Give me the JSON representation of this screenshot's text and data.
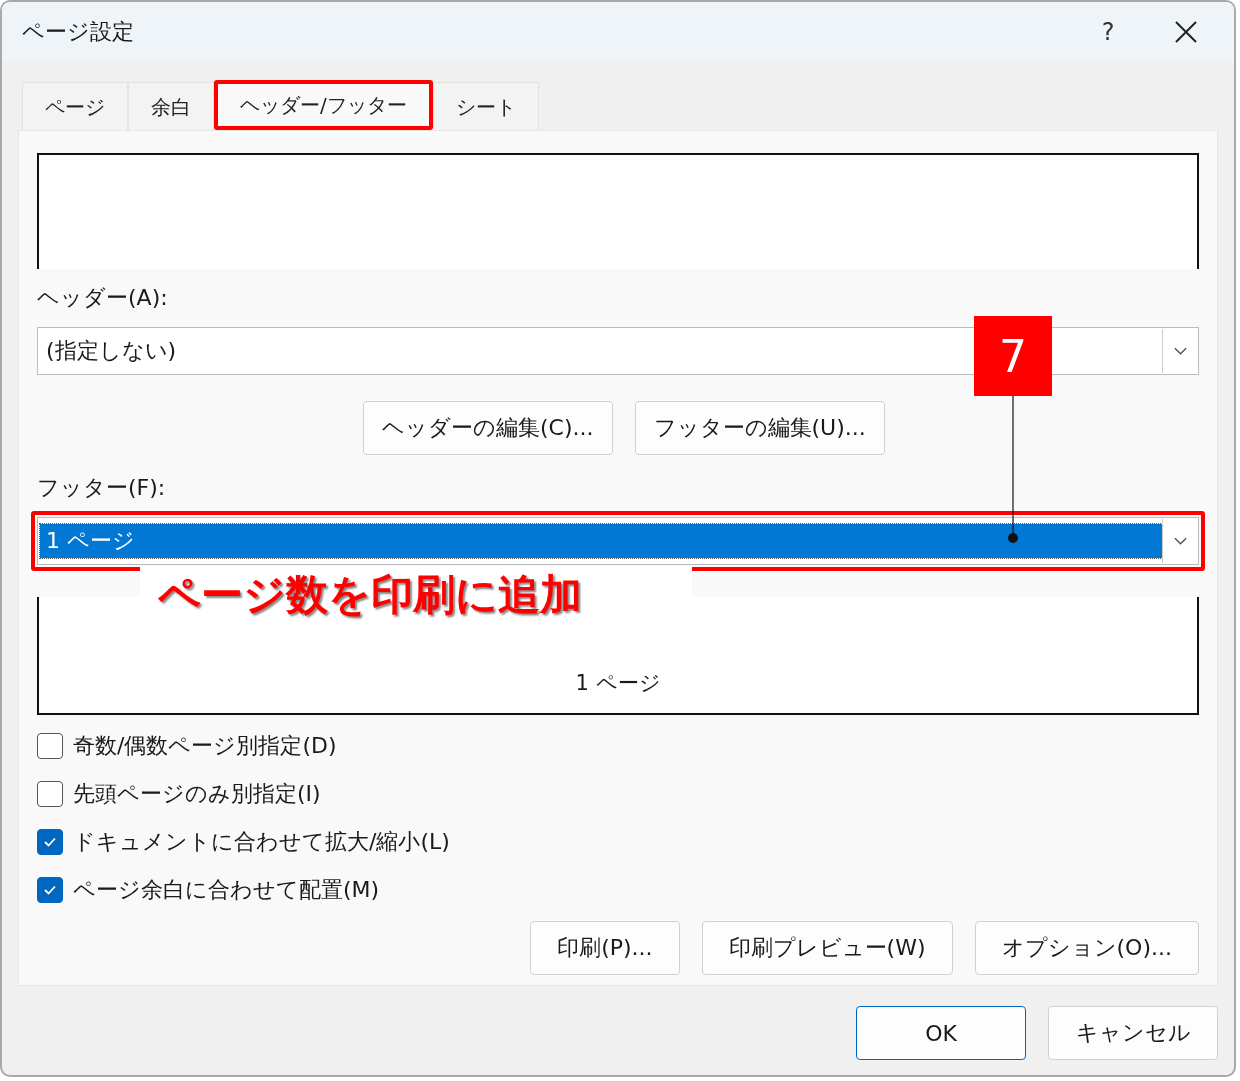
{
  "window": {
    "title": "ページ設定",
    "help": "?"
  },
  "tabs": [
    {
      "label": "ページ",
      "selected": false,
      "highlighted": false
    },
    {
      "label": "余白",
      "selected": false,
      "highlighted": false
    },
    {
      "label": "ヘッダー/フッター",
      "selected": true,
      "highlighted": true
    },
    {
      "label": "シート",
      "selected": false,
      "highlighted": false
    }
  ],
  "header": {
    "label": "ヘッダー(A):",
    "value": "(指定しない)",
    "selected": false,
    "highlighted": false
  },
  "edit_buttons": [
    {
      "label": "ヘッダーの編集(C)..."
    },
    {
      "label": "フッターの編集(U)..."
    }
  ],
  "footer": {
    "label": "フッター(F):",
    "value": "1 ページ",
    "selected": true,
    "highlighted": true,
    "preview_text": "1 ページ"
  },
  "options": [
    {
      "label": "奇数/偶数ページ別指定(D)",
      "checked": false
    },
    {
      "label": "先頭ページのみ別指定(I)",
      "checked": false
    },
    {
      "label": "ドキュメントに合わせて拡大/縮小(L)",
      "checked": true
    },
    {
      "label": "ページ余白に合わせて配置(M)",
      "checked": true
    }
  ],
  "action_buttons": [
    {
      "label": "印刷(P)..."
    },
    {
      "label": "印刷プレビュー(W)"
    },
    {
      "label": "オプション(O)..."
    }
  ],
  "dialog_buttons": [
    {
      "label": "OK",
      "default": true
    },
    {
      "label": "キャンセル",
      "default": false
    }
  ],
  "annotation": {
    "step": "7",
    "caption": "ページ数を印刷に追加"
  }
}
